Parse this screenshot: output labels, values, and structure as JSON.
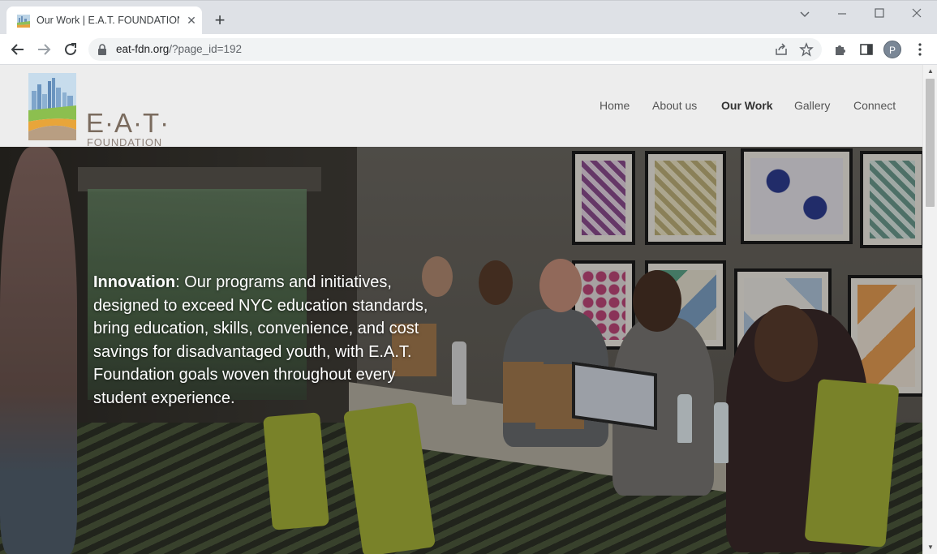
{
  "browser": {
    "tab_title": "Our Work | E.A.T. FOUNDATION",
    "url_host": "eat-fdn.org",
    "url_path": "/?page_id=192",
    "profile_initial": "P"
  },
  "site": {
    "logo_word": "E·A·T·",
    "logo_sub": "FOUNDATION",
    "nav": [
      {
        "label": "Home"
      },
      {
        "label": "About us"
      },
      {
        "label": "Our Work"
      },
      {
        "label": "Gallery"
      },
      {
        "label": "Connect"
      }
    ],
    "active_nav": "Our Work"
  },
  "hero": {
    "bold_label": "Innovation",
    "body": ": Our programs and initiatives, designed to exceed NYC education standards, bring education, skills, convenience, and cost savings for disadvantaged youth, with E.A.T. Foundation goals woven throughout every student experience."
  }
}
